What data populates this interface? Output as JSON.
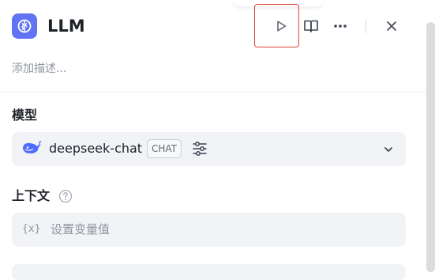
{
  "node": {
    "title": "LLM",
    "icon": "llm-brain-icon",
    "accent_color": "#6172f3",
    "description_placeholder": "添加描述..."
  },
  "header_actions": [
    {
      "name": "run-icon"
    },
    {
      "name": "book-icon"
    },
    {
      "name": "more-icon"
    },
    {
      "name": "close-icon"
    }
  ],
  "model_section": {
    "label": "模型",
    "model_name": "deepseek-chat",
    "badge": "CHAT",
    "provider_icon": "deepseek-whale-icon",
    "settings_icon": "sliders-icon",
    "dropdown_icon": "chevron-down-icon"
  },
  "context_section": {
    "label": "上下文",
    "help_icon": "question-circle-icon",
    "var_prefix": "{x}",
    "placeholder": "设置变量值"
  }
}
